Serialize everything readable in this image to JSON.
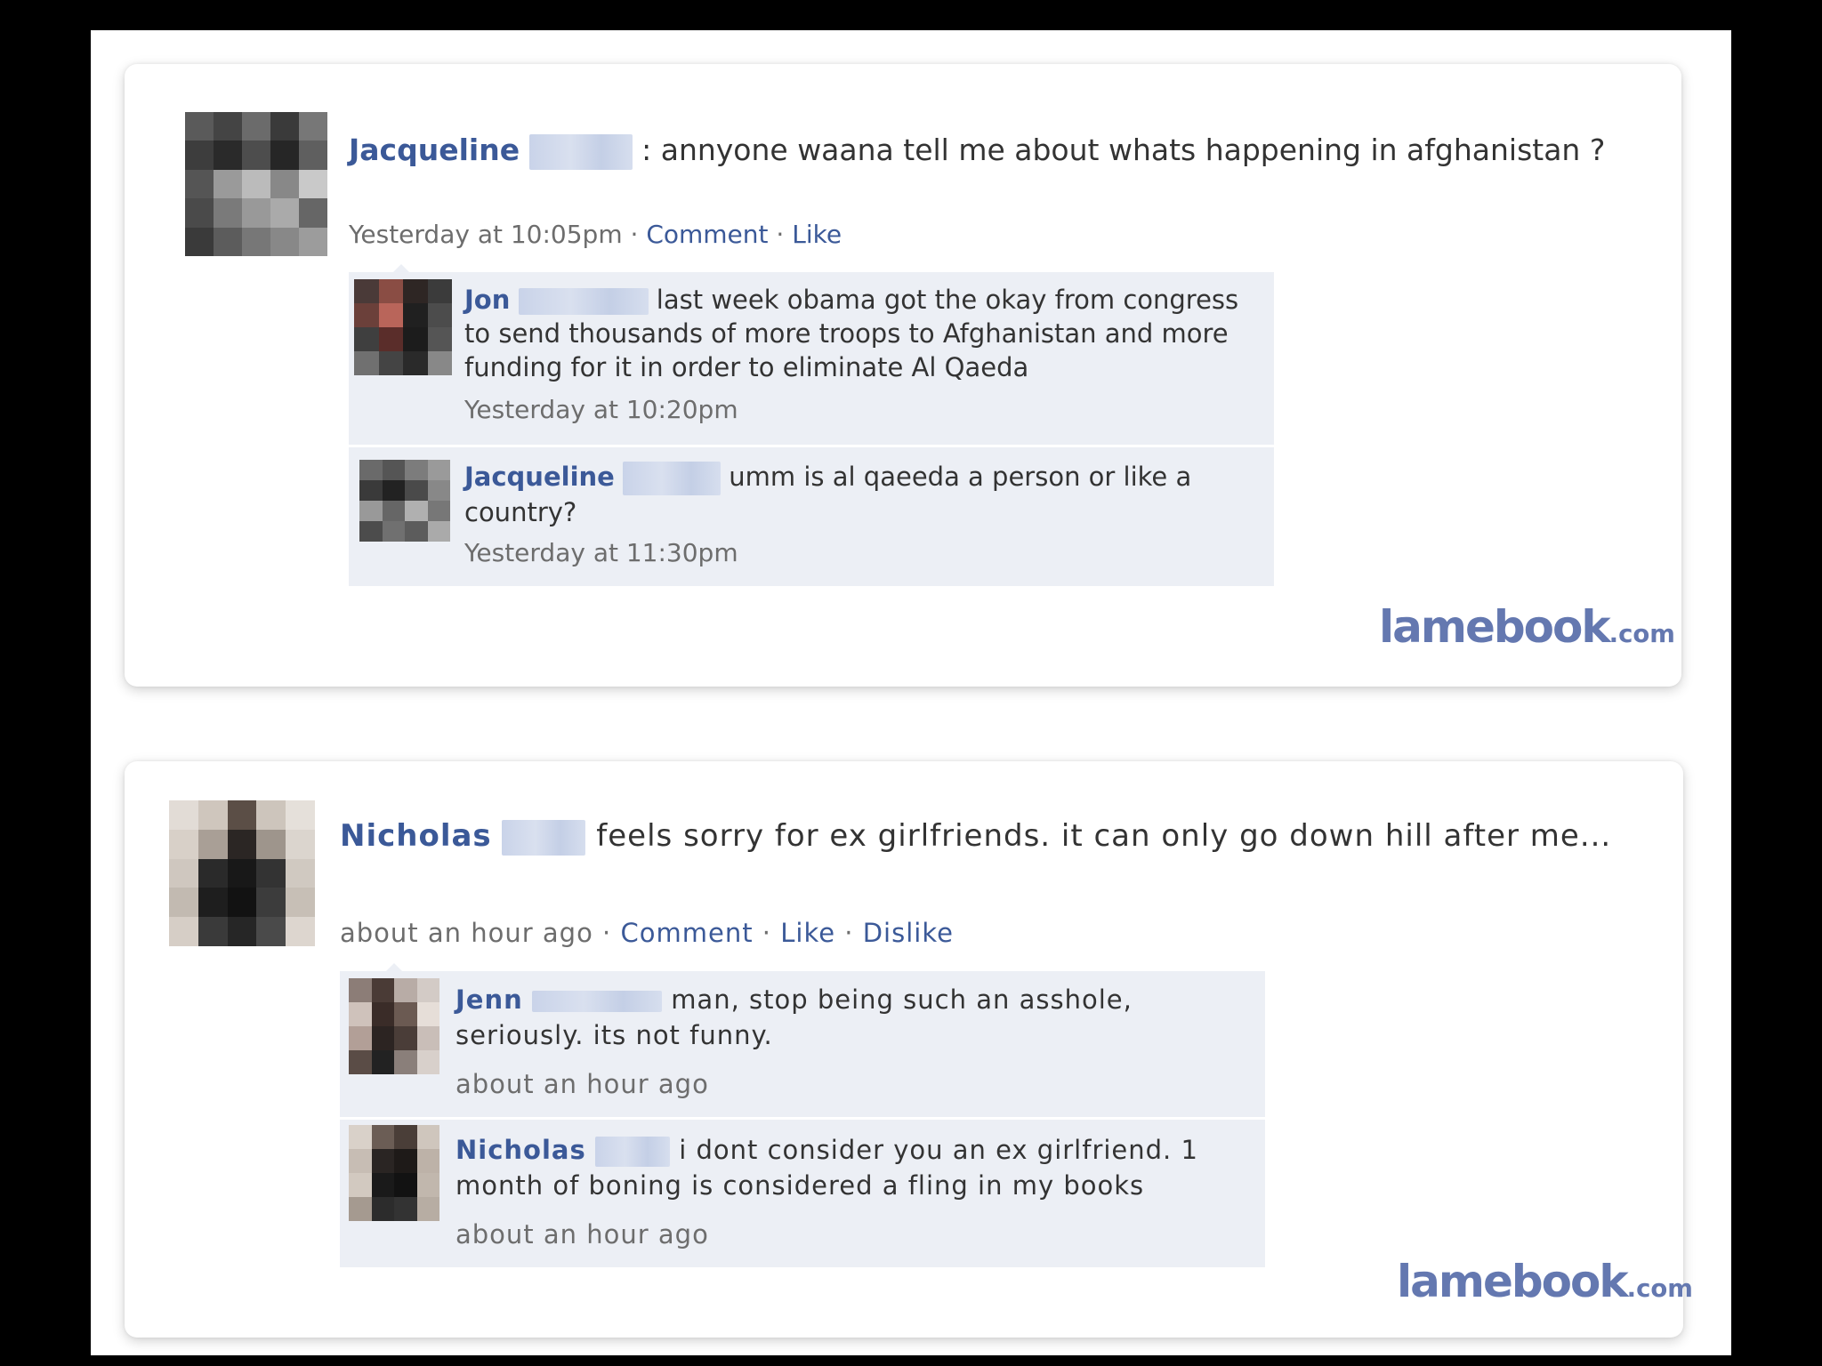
{
  "posts": [
    {
      "author": "Jacqueline",
      "text": ": annyone waana tell me about whats happening in afghanistan ?",
      "time": "Yesterday at 10:05pm",
      "actions": [
        "Comment",
        "Like"
      ],
      "comments": [
        {
          "author": "Jon",
          "text": "last week obama got the okay from congress to send thousands of more troops to Afghanistan and more funding for it in order to eliminate Al Qaeda",
          "time": "Yesterday at 10:20pm"
        },
        {
          "author": "Jacqueline",
          "text": "umm is al qaeeda a person or like a country?",
          "time": "Yesterday at 11:30pm"
        }
      ],
      "watermark": "lamebook",
      "watermark_tld": ".com"
    },
    {
      "author": "Nicholas",
      "text": "feels sorry for ex girlfriends. it can only go down hill after me...",
      "time": "about an hour ago",
      "actions": [
        "Comment",
        "Like",
        "Dislike"
      ],
      "comments": [
        {
          "author": "Jenn",
          "text": "man, stop being such an asshole, seriously. its not funny.",
          "time": "about an hour ago"
        },
        {
          "author": "Nicholas",
          "text": "i dont consider you an ex girlfriend. 1 month of boning is considered a fling in my books",
          "time": "about an hour ago"
        }
      ],
      "watermark": "lamebook",
      "watermark_tld": ".com"
    }
  ],
  "separator": "·"
}
